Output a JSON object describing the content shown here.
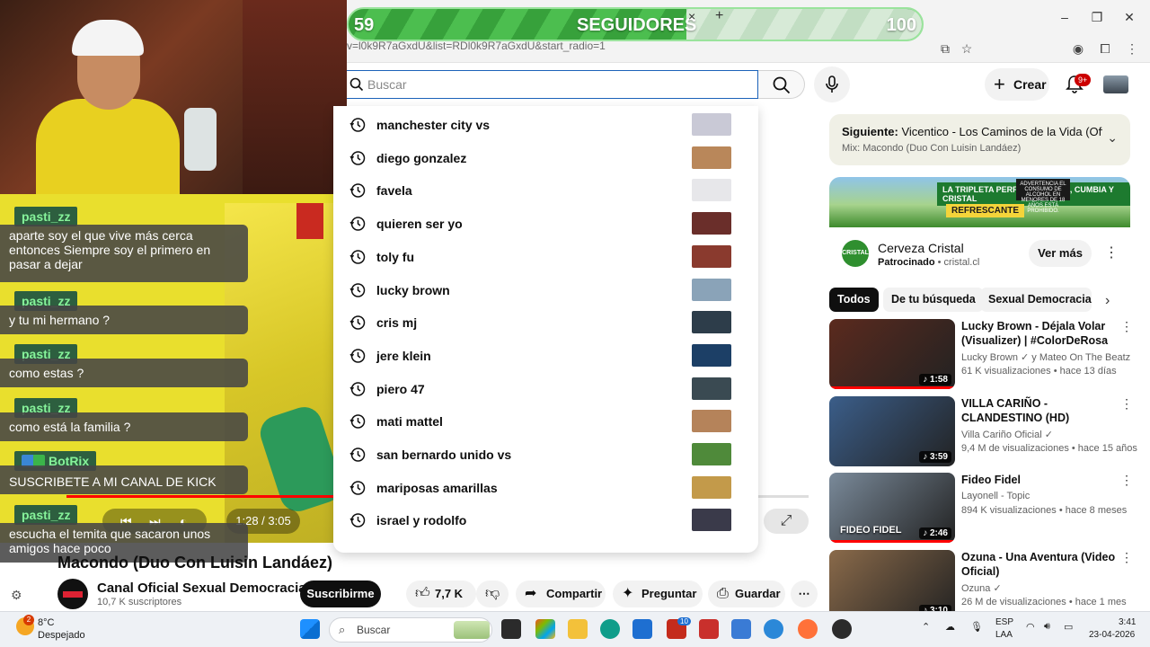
{
  "browser": {
    "url": "v=l0k9R7aGxdU&list=RDl0k9R7aGxdU&start_radio=1",
    "tab_close": "×",
    "new_tab": "+"
  },
  "overlay": {
    "followers_current": "59",
    "followers_label": "SEGUIDORES",
    "followers_goal": "100",
    "progress_fraction": 0.59
  },
  "search": {
    "placeholder": "Buscar",
    "suggestions": [
      {
        "text": "manchester city vs",
        "thumb": "#c9c9d6"
      },
      {
        "text": "diego gonzalez",
        "thumb": "#b9875a"
      },
      {
        "text": "favela",
        "thumb": "#e7e7ea"
      },
      {
        "text": "quieren ser yo",
        "thumb": "#6a2e2a"
      },
      {
        "text": "toly fu",
        "thumb": "#8a3a2e"
      },
      {
        "text": "lucky brown",
        "thumb": "#8aa3b8"
      },
      {
        "text": "cris mj",
        "thumb": "#2d3d4a"
      },
      {
        "text": "jere klein",
        "thumb": "#1c3f66"
      },
      {
        "text": "piero 47",
        "thumb": "#3a4a52"
      },
      {
        "text": "mati mattel",
        "thumb": "#b5835a"
      },
      {
        "text": "san bernardo unido vs",
        "thumb": "#4f8a3a"
      },
      {
        "text": "mariposas amarillas",
        "thumb": "#c39a4a"
      },
      {
        "text": "israel y rodolfo",
        "thumb": "#3a3a4a"
      }
    ]
  },
  "header": {
    "create_label": "Crear",
    "notif_badge": "9+"
  },
  "chat": [
    {
      "user": "pasti_zz",
      "message": "aparte soy el que vive más cerca entonces Siempre soy el primero en pasar a dejar"
    },
    {
      "user": "pasti_zz",
      "message": "y tu mi hermano ?"
    },
    {
      "user": "pasti_zz",
      "message": "como estas ?"
    },
    {
      "user": "pasti_zz",
      "message": "como está la familia ?"
    },
    {
      "user": "BotRix",
      "message": "SUSCRIBETE A MI CANAL DE KICK"
    },
    {
      "user": "pasti_zz",
      "message": "escucha el temita que sacaron unos amigos hace poco"
    }
  ],
  "player": {
    "time": "1:28 / 3:05",
    "progress_fraction": 0.4
  },
  "video": {
    "title": "Macondo (Duo Con Luisin Landáez)",
    "channel": "Canal Oficial Sexual Democracia",
    "subscribers": "10,7 K suscriptores",
    "subscribe_label": "Suscribirme",
    "likes": "7,7 K",
    "share_label": "Compartir",
    "ask_label": "Preguntar",
    "save_label": "Guardar"
  },
  "sidebar": {
    "next_prefix": "Siguiente:",
    "next_title": "Vicentico - Los Caminos de la Vida (Offic...",
    "next_mix": "Mix: Macondo (Duo Con Luisin Landáez)",
    "ad": {
      "banner_top": "LA TRIPLETA PERFECTA ASADO, CUMBIA Y CRISTAL",
      "banner_bottom": "REFRESCANTE",
      "warning": "ADVERTENCIA EL CONSUMO DE ALCOHOL EN MENORES DE 18 AÑOS ESTÁ PROHIBIDO.",
      "logo": "CRISTAL",
      "name": "Cerveza Cristal",
      "sponsored": "Patrocinado",
      "domain": "cristal.cl",
      "cta": "Ver más"
    },
    "chips": [
      "Todos",
      "De tu búsqueda",
      "Sexual Democracia - T"
    ],
    "videos": [
      {
        "title": "Lucky Brown - Déjala Volar (Visualizer) | #ColorDeRosa",
        "channel": "Lucky Brown ✓ y Mateo On The Beatz",
        "stats": "61 K visualizaciones • hace 13 días",
        "duration": "♪ 1:58",
        "thumb": "#5b2a1e"
      },
      {
        "title": "VILLA CARIÑO - CLANDESTINO (HD)",
        "channel": "Villa Cariño Oficial ✓",
        "stats": "9,4 M de visualizaciones • hace 15 años",
        "duration": "♪ 3:59",
        "thumb": "#3b5e8a"
      },
      {
        "title": "Fideo Fidel",
        "channel": "Layonell - Topic",
        "stats": "894 K visualizaciones • hace 8 meses",
        "duration": "♪ 2:46",
        "thumb": "#7a8a9a",
        "overlay": "FIDEO FIDEL"
      },
      {
        "title": "Ozuna - Una Aventura (Video Oficial)",
        "channel": "Ozuna ✓",
        "stats": "26 M de visualizaciones • hace 1 mes",
        "duration": "♪ 3:10",
        "thumb": "#8a6a4a"
      }
    ]
  },
  "taskbar": {
    "temperature": "8°C",
    "weather": "Despejado",
    "weather_badge": "2",
    "search_label": "Buscar",
    "app_badge": "10",
    "lang1": "ESP",
    "lang2": "LAA",
    "time": "3:41",
    "date": "23-04-2026"
  }
}
